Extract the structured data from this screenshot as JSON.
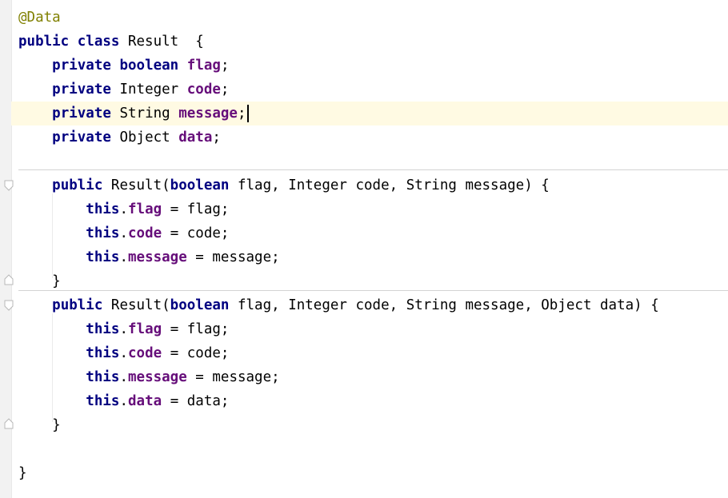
{
  "editor": {
    "lines": [
      {
        "id": "l1",
        "tokens": [
          {
            "t": "@Data",
            "k": "ann"
          }
        ]
      },
      {
        "id": "l2",
        "tokens": [
          {
            "t": "public",
            "k": "kw"
          },
          {
            "t": " "
          },
          {
            "t": "class",
            "k": "kw"
          },
          {
            "t": " Result  {"
          }
        ]
      },
      {
        "id": "l3",
        "tokens": [
          {
            "t": "    "
          },
          {
            "t": "private",
            "k": "kw"
          },
          {
            "t": " "
          },
          {
            "t": "boolean",
            "k": "kw"
          },
          {
            "t": " "
          },
          {
            "t": "flag",
            "k": "fld"
          },
          {
            "t": ";"
          }
        ]
      },
      {
        "id": "l4",
        "tokens": [
          {
            "t": "    "
          },
          {
            "t": "private",
            "k": "kw"
          },
          {
            "t": " Integer "
          },
          {
            "t": "code",
            "k": "fld"
          },
          {
            "t": ";"
          }
        ]
      },
      {
        "id": "l5",
        "current": true,
        "tokens": [
          {
            "t": "    "
          },
          {
            "t": "private",
            "k": "kw"
          },
          {
            "t": " String "
          },
          {
            "t": "message",
            "k": "fld"
          },
          {
            "t": ";"
          }
        ]
      },
      {
        "id": "l6",
        "tokens": [
          {
            "t": "    "
          },
          {
            "t": "private",
            "k": "kw"
          },
          {
            "t": " Object "
          },
          {
            "t": "data",
            "k": "fld"
          },
          {
            "t": ";"
          }
        ]
      },
      {
        "id": "l7",
        "tokens": []
      },
      {
        "id": "l8",
        "tokens": [
          {
            "t": "    "
          },
          {
            "t": "public",
            "k": "kw"
          },
          {
            "t": " Result("
          },
          {
            "t": "boolean",
            "k": "kw"
          },
          {
            "t": " flag, Integer code, String message) {"
          }
        ]
      },
      {
        "id": "l9",
        "tokens": [
          {
            "t": "        "
          },
          {
            "t": "this",
            "k": "kw"
          },
          {
            "t": "."
          },
          {
            "t": "flag",
            "k": "fld"
          },
          {
            "t": " = flag;"
          }
        ]
      },
      {
        "id": "l10",
        "tokens": [
          {
            "t": "        "
          },
          {
            "t": "this",
            "k": "kw"
          },
          {
            "t": "."
          },
          {
            "t": "code",
            "k": "fld"
          },
          {
            "t": " = code;"
          }
        ]
      },
      {
        "id": "l11",
        "tokens": [
          {
            "t": "        "
          },
          {
            "t": "this",
            "k": "kw"
          },
          {
            "t": "."
          },
          {
            "t": "message",
            "k": "fld"
          },
          {
            "t": " = message;"
          }
        ]
      },
      {
        "id": "l12",
        "tokens": [
          {
            "t": "    }"
          }
        ]
      },
      {
        "id": "l13",
        "tokens": [
          {
            "t": "    "
          },
          {
            "t": "public",
            "k": "kw"
          },
          {
            "t": " Result("
          },
          {
            "t": "boolean",
            "k": "kw"
          },
          {
            "t": " flag, Integer code, String message, Object data) {"
          }
        ]
      },
      {
        "id": "l14",
        "tokens": [
          {
            "t": "        "
          },
          {
            "t": "this",
            "k": "kw"
          },
          {
            "t": "."
          },
          {
            "t": "flag",
            "k": "fld"
          },
          {
            "t": " = flag;"
          }
        ]
      },
      {
        "id": "l15",
        "tokens": [
          {
            "t": "        "
          },
          {
            "t": "this",
            "k": "kw"
          },
          {
            "t": "."
          },
          {
            "t": "code",
            "k": "fld"
          },
          {
            "t": " = code;"
          }
        ]
      },
      {
        "id": "l16",
        "tokens": [
          {
            "t": "        "
          },
          {
            "t": "this",
            "k": "kw"
          },
          {
            "t": "."
          },
          {
            "t": "message",
            "k": "fld"
          },
          {
            "t": " = message;"
          }
        ]
      },
      {
        "id": "l17",
        "tokens": [
          {
            "t": "        "
          },
          {
            "t": "this",
            "k": "kw"
          },
          {
            "t": "."
          },
          {
            "t": "data",
            "k": "fld"
          },
          {
            "t": " = data;"
          }
        ]
      },
      {
        "id": "l18",
        "tokens": [
          {
            "t": "    }"
          }
        ]
      },
      {
        "id": "l19",
        "tokens": []
      },
      {
        "id": "l20",
        "tokens": [
          {
            "t": "}"
          }
        ]
      }
    ]
  },
  "colors": {
    "keyword": "#000080",
    "field": "#660e7a",
    "annotation": "#808000",
    "current_line": "#fffae3"
  },
  "icons": [
    "fold-start-icon",
    "fold-end-icon"
  ]
}
